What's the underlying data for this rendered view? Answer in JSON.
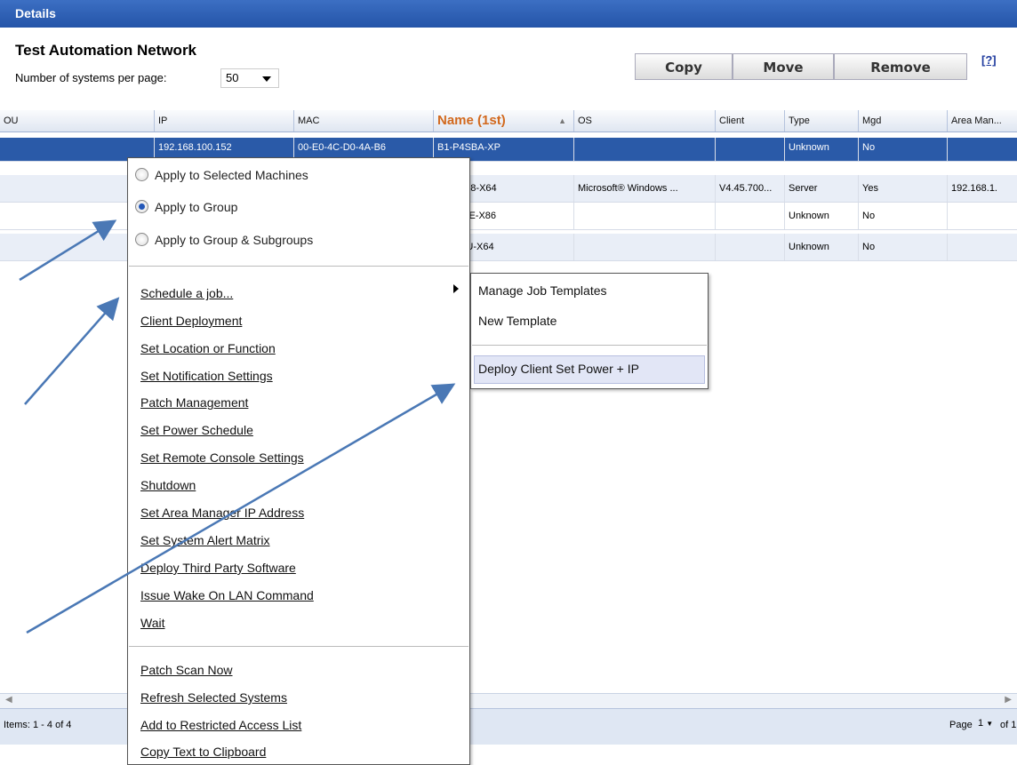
{
  "window": {
    "title": "Details"
  },
  "page": {
    "title": "Test Automation Network",
    "per_page_label": "Number of systems per page:",
    "per_page_value": "50"
  },
  "toolbar": {
    "copy_label": "Copy",
    "move_label": "Move",
    "remove_label": "Remove",
    "help_label": "[?]"
  },
  "grid": {
    "columns": [
      "OU",
      "IP",
      "MAC",
      "Name (1st)",
      "OS",
      "Client",
      "Type",
      "Mgd",
      "Area Man..."
    ],
    "rows": [
      {
        "ou": "",
        "ip": "192.168.100.152",
        "mac": "00-E0-4C-D0-4A-B6",
        "name": "B1-P4SBA-XP",
        "os": "",
        "client": "",
        "type": "Unknown",
        "mgd": "No",
        "area": ""
      },
      {
        "ou": "",
        "ip": "",
        "mac": "",
        "name": "LD-2K08-X64",
        "os": "Microsoft® Windows ...",
        "client": "V4.45.700...",
        "type": "Server",
        "mgd": "Yes",
        "area": "192.168.1."
      },
      {
        "ou": "",
        "ip": "",
        "mac": "",
        "name": "PR-W7E-X86",
        "os": "",
        "client": "",
        "type": "Unknown",
        "mgd": "No",
        "area": ""
      },
      {
        "ou": "",
        "ip": "",
        "mac": "",
        "name": "51-W7U-X64",
        "os": "",
        "client": "",
        "type": "Unknown",
        "mgd": "No",
        "area": ""
      }
    ]
  },
  "footer": {
    "items_label": "Items: 1 - 4 of 4",
    "page_label": "Page",
    "page_value": "1",
    "of_label": "of 1"
  },
  "context_menu": {
    "radios": [
      {
        "label": "Apply to Selected Machines",
        "checked": false
      },
      {
        "label": "Apply to Group",
        "checked": true
      },
      {
        "label": "Apply to Group & Subgroups",
        "checked": false
      }
    ],
    "items_group1": [
      "Schedule a job...",
      "Client Deployment",
      "Set Location or Function",
      "Set Notification Settings",
      "Patch Management",
      "Set Power Schedule",
      "Set Remote Console Settings",
      "Shutdown",
      "Set Area Manager IP Address",
      "Set System Alert Matrix",
      "Deploy Third Party Software",
      "Issue Wake On LAN Command",
      "Wait"
    ],
    "items_group2": [
      "Patch Scan Now",
      "Refresh Selected Systems",
      "Add to Restricted Access List",
      "Copy Text to Clipboard"
    ]
  },
  "submenu": {
    "items": [
      "Manage Job Templates",
      "New Template",
      "Deploy Client Set Power + IP"
    ]
  },
  "colors": {
    "title_bar": "#2454a8",
    "selection": "#2a5aa8",
    "sort_column": "#d2691e",
    "arrow": "#4a78b5"
  }
}
